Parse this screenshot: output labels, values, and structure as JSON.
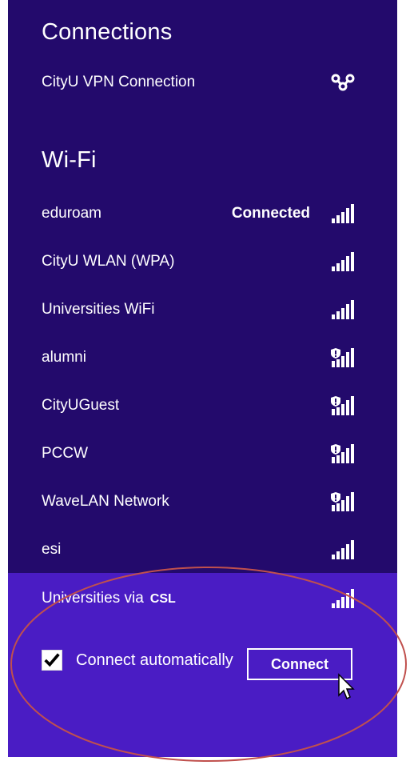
{
  "connections": {
    "title": "Connections",
    "vpn": {
      "label": "CityU VPN Connection",
      "icon": "vpn-icon"
    }
  },
  "wifi": {
    "title": "Wi-Fi",
    "networks": [
      {
        "name": "eduroam",
        "status": "Connected",
        "secured": false
      },
      {
        "name": "CityU WLAN (WPA)",
        "status": "",
        "secured": false
      },
      {
        "name": "Universities WiFi",
        "status": "",
        "secured": false
      },
      {
        "name": "alumni",
        "status": "",
        "secured": true
      },
      {
        "name": "CityUGuest",
        "status": "",
        "secured": true
      },
      {
        "name": "PCCW",
        "status": "",
        "secured": true
      },
      {
        "name": "WaveLAN Network",
        "status": "",
        "secured": true
      },
      {
        "name": "esi",
        "status": "",
        "secured": false
      }
    ]
  },
  "selected": {
    "name": "Universities via",
    "name_suffix": "CSL",
    "connect_automatically_label": "Connect automatically",
    "connect_automatically_checked": true,
    "connect_button": "Connect"
  },
  "colors": {
    "panel_bg": "#230a6c",
    "selected_bg": "#4a1cc4",
    "annotation_ellipse": "#c0504d"
  }
}
